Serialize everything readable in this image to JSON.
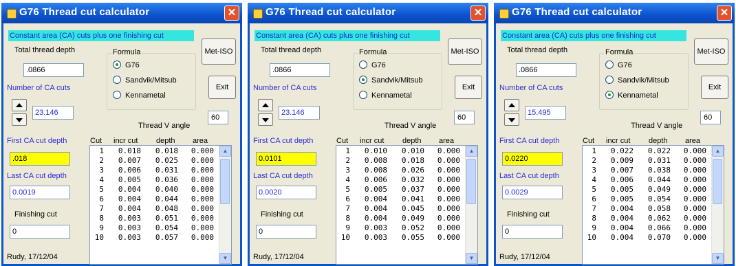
{
  "windows": [
    {
      "title": "G76 Thread cut calculator",
      "close": "✕",
      "banner": "Constant area (CA) cuts plus one finishing cut",
      "total_depth_label": "Total thread depth",
      "total_depth_value": ".0866",
      "num_cuts_label": "Number of CA cuts",
      "num_cuts_value": "23.146",
      "formula_label": "Formula",
      "formula_options": [
        "G76",
        "Sandvik/Mitsub",
        "Kennametal"
      ],
      "formula_selected": 0,
      "met_iso_button": "Met-ISO",
      "exit_button": "Exit",
      "angle_value": "60",
      "angle_label": "Thread V angle",
      "first_cut_label": "First CA cut depth",
      "first_cut_value": ".018",
      "last_cut_label": "Last CA cut depth",
      "last_cut_value": "0.0019",
      "finishing_label": "Finishing cut",
      "finishing_value": "0",
      "footer": "Rudy, 17/12/04",
      "columns": [
        "Cut",
        "incr cut",
        "depth",
        "area"
      ],
      "rows": [
        [
          "1",
          "0.018",
          "0.018",
          "0.000"
        ],
        [
          "2",
          "0.007",
          "0.025",
          "0.000"
        ],
        [
          "3",
          "0.006",
          "0.031",
          "0.000"
        ],
        [
          "4",
          "0.005",
          "0.036",
          "0.000"
        ],
        [
          "5",
          "0.004",
          "0.040",
          "0.000"
        ],
        [
          "6",
          "0.004",
          "0.044",
          "0.000"
        ],
        [
          "7",
          "0.004",
          "0.048",
          "0.000"
        ],
        [
          "8",
          "0.003",
          "0.051",
          "0.000"
        ],
        [
          "9",
          "0.003",
          "0.054",
          "0.000"
        ],
        [
          "10",
          "0.003",
          "0.057",
          "0.000"
        ]
      ]
    },
    {
      "title": "G76 Thread cut calculator",
      "close": "✕",
      "banner": "Constant area (CA) cuts plus one finishing cut",
      "total_depth_label": "Total thread depth",
      "total_depth_value": ".0866",
      "num_cuts_label": "Number of CA cuts",
      "num_cuts_value": "23.146",
      "formula_label": "Formula",
      "formula_options": [
        "G76",
        "Sandvik/Mitsub",
        "Kennametal"
      ],
      "formula_selected": 1,
      "met_iso_button": "Met-ISO",
      "exit_button": "Exit",
      "angle_value": "60",
      "angle_label": "Thread V angle",
      "first_cut_label": "First CA cut depth",
      "first_cut_value": "0.0101",
      "last_cut_label": "Last CA cut depth",
      "last_cut_value": "0.0020",
      "finishing_label": "Finishing cut",
      "finishing_value": "0",
      "footer": "Rudy, 17/12/04",
      "columns": [
        "Cut",
        "incr cut",
        "depth",
        "area"
      ],
      "rows": [
        [
          "1",
          "0.010",
          "0.010",
          "0.000"
        ],
        [
          "2",
          "0.008",
          "0.018",
          "0.000"
        ],
        [
          "3",
          "0.008",
          "0.026",
          "0.000"
        ],
        [
          "4",
          "0.006",
          "0.032",
          "0.000"
        ],
        [
          "5",
          "0.005",
          "0.037",
          "0.000"
        ],
        [
          "6",
          "0.004",
          "0.041",
          "0.000"
        ],
        [
          "7",
          "0.004",
          "0.045",
          "0.000"
        ],
        [
          "8",
          "0.004",
          "0.049",
          "0.000"
        ],
        [
          "9",
          "0.003",
          "0.052",
          "0.000"
        ],
        [
          "10",
          "0.003",
          "0.055",
          "0.000"
        ]
      ]
    },
    {
      "title": "G76 Thread cut calculator",
      "close": "✕",
      "banner": "Constant area (CA) cuts plus one finishing cut",
      "total_depth_label": "Total thread depth",
      "total_depth_value": ".0866",
      "num_cuts_label": "Number of CA cuts",
      "num_cuts_value": "15.495",
      "formula_label": "Formula",
      "formula_options": [
        "G76",
        "Sandvik/Mitsub",
        "Kennametal"
      ],
      "formula_selected": 2,
      "met_iso_button": "Met-ISO",
      "exit_button": "Exit",
      "angle_value": "60",
      "angle_label": "Thread V angle",
      "first_cut_label": "First CA cut depth",
      "first_cut_value": "0.0220",
      "last_cut_label": "Last CA cut depth",
      "last_cut_value": "0.0029",
      "finishing_label": "Finishing cut",
      "finishing_value": "0",
      "footer": "Rudy, 17/12/04",
      "columns": [
        "Cut",
        "incr cut",
        "depth",
        "area"
      ],
      "rows": [
        [
          "1",
          "0.022",
          "0.022",
          "0.000"
        ],
        [
          "2",
          "0.009",
          "0.031",
          "0.000"
        ],
        [
          "3",
          "0.007",
          "0.038",
          "0.000"
        ],
        [
          "4",
          "0.006",
          "0.044",
          "0.000"
        ],
        [
          "5",
          "0.005",
          "0.049",
          "0.000"
        ],
        [
          "6",
          "0.005",
          "0.054",
          "0.000"
        ],
        [
          "7",
          "0.004",
          "0.058",
          "0.000"
        ],
        [
          "8",
          "0.004",
          "0.062",
          "0.000"
        ],
        [
          "9",
          "0.004",
          "0.066",
          "0.000"
        ],
        [
          "10",
          "0.004",
          "0.070",
          "0.000"
        ]
      ]
    }
  ]
}
